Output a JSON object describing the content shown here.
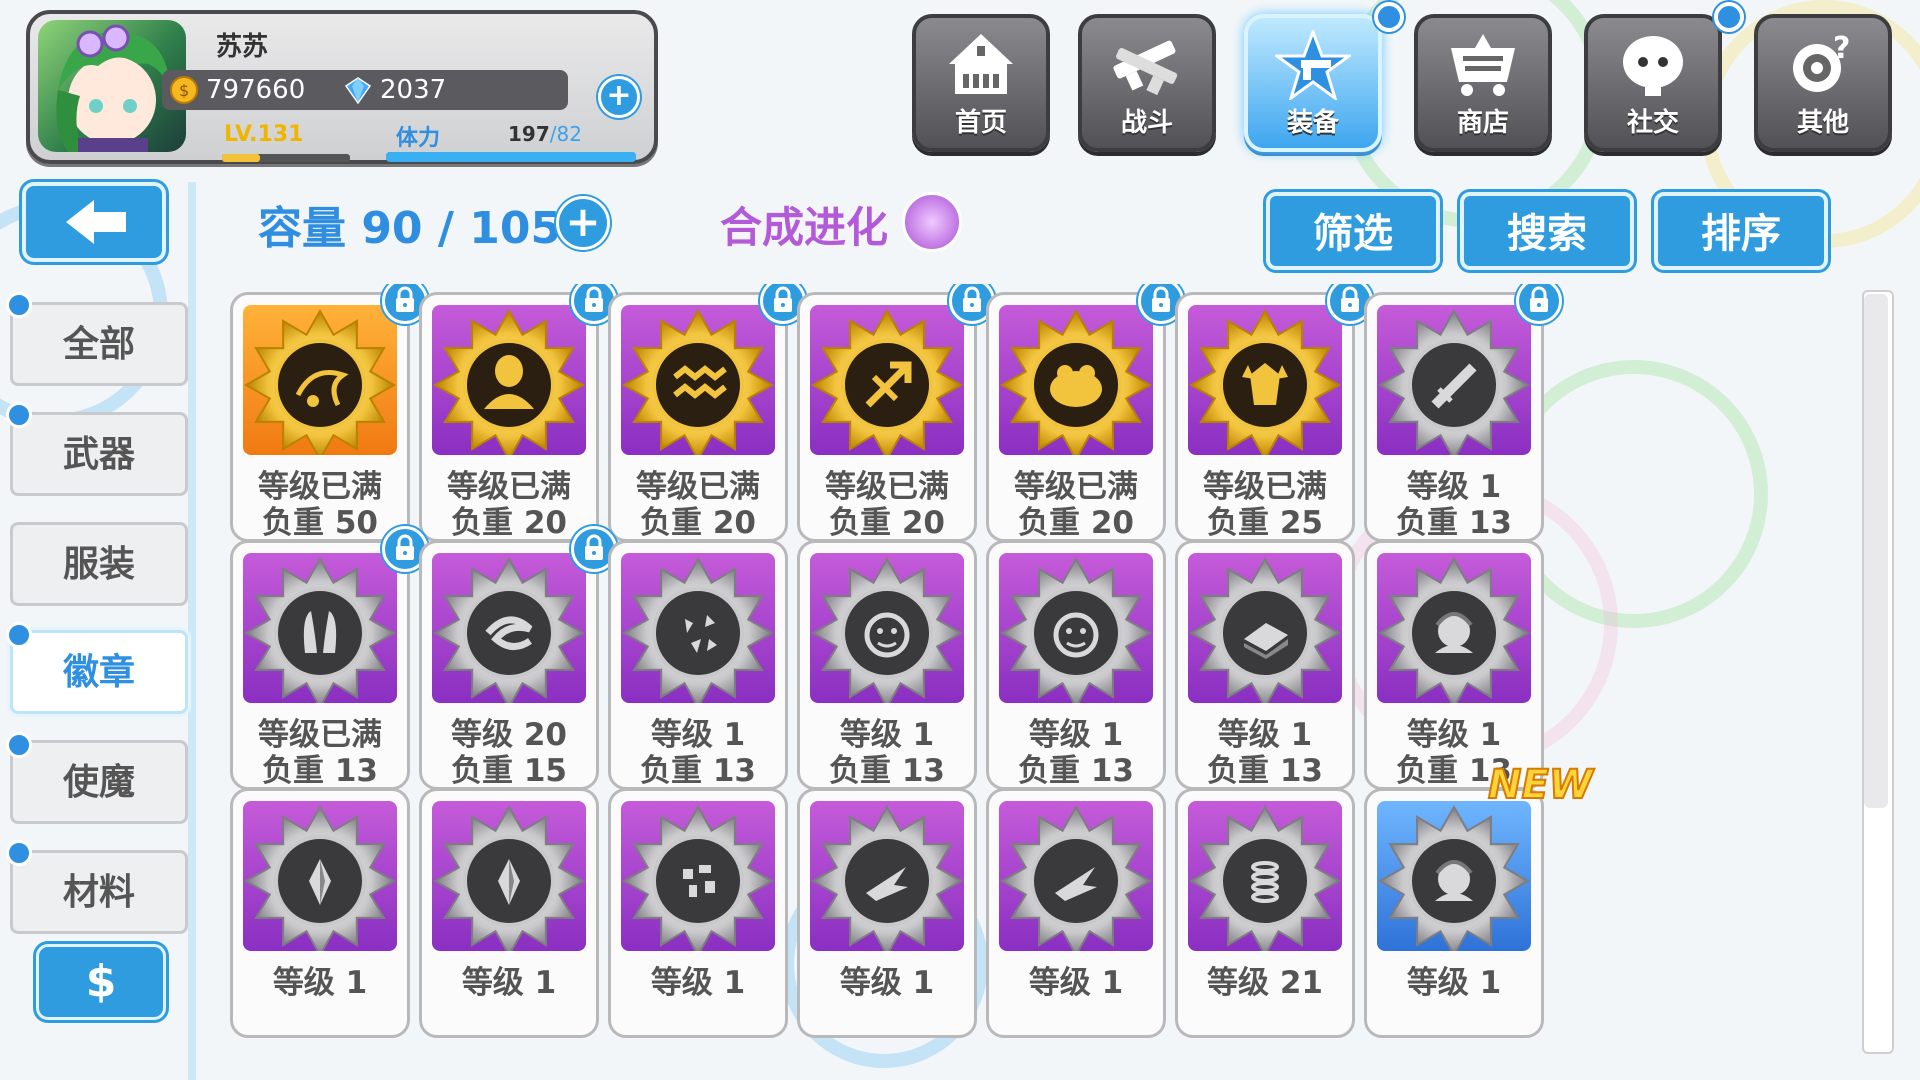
{
  "player": {
    "name": "苏苏",
    "gold": "797660",
    "gems": "2037",
    "level": "LV.131",
    "stamina_label": "体力",
    "stamina_current": "197",
    "stamina_max": "/82",
    "level_progress": 0.3,
    "stamina_progress": 1.0
  },
  "nav": {
    "items": [
      {
        "label": "首页",
        "icon": "house-icon",
        "active": false
      },
      {
        "label": "战斗",
        "icon": "crossed-guns-icon",
        "active": false
      },
      {
        "label": "装备",
        "icon": "star-gun-icon",
        "active": true
      },
      {
        "label": "商店",
        "icon": "cart-icon",
        "active": false
      },
      {
        "label": "社交",
        "icon": "ghost-face-icon",
        "active": false
      },
      {
        "label": "其他",
        "icon": "gear-target-icon",
        "active": false
      }
    ]
  },
  "sidebar": {
    "items": [
      {
        "label": "全部",
        "active": false
      },
      {
        "label": "武器",
        "active": false
      },
      {
        "label": "服装",
        "active": false
      },
      {
        "label": "徽章",
        "active": true
      },
      {
        "label": "使魔",
        "active": false
      },
      {
        "label": "材料",
        "active": false
      }
    ],
    "coin_button": "$"
  },
  "header": {
    "capacity": "容量 90 / 105",
    "synthesis": "合成进化",
    "filter": "筛选",
    "search": "搜索",
    "sort": "排序"
  },
  "badges": [
    {
      "line1": "等级已满",
      "line2": "负重 50",
      "frame": "gold",
      "bg": "orange",
      "locked": true,
      "motif": "vine"
    },
    {
      "line1": "等级已满",
      "line2": "负重 20",
      "frame": "gold",
      "bg": "purple",
      "locked": true,
      "motif": "figure"
    },
    {
      "line1": "等级已满",
      "line2": "负重 20",
      "frame": "gold",
      "bg": "purple",
      "locked": true,
      "motif": "aquarius"
    },
    {
      "line1": "等级已满",
      "line2": "负重 20",
      "frame": "gold",
      "bg": "purple",
      "locked": true,
      "motif": "sagittarius"
    },
    {
      "line1": "等级已满",
      "line2": "负重 20",
      "frame": "gold",
      "bg": "purple",
      "locked": true,
      "motif": "frog"
    },
    {
      "line1": "等级已满",
      "line2": "负重 25",
      "frame": "gold",
      "bg": "purple",
      "locked": true,
      "motif": "demon"
    },
    {
      "line1": "等级 1",
      "line2": "负重 13",
      "frame": "silver",
      "bg": "purple",
      "locked": true,
      "motif": "sword"
    },
    {
      "line1": "等级已满",
      "line2": "负重 13",
      "frame": "silver",
      "bg": "purple",
      "locked": true,
      "motif": "ears"
    },
    {
      "line1": "等级 20",
      "line2": "负重 15",
      "frame": "silver",
      "bg": "purple",
      "locked": true,
      "motif": "swirl"
    },
    {
      "line1": "等级 1",
      "line2": "负重 13",
      "frame": "silver",
      "bg": "purple",
      "locked": false,
      "motif": "shards"
    },
    {
      "line1": "等级 1",
      "line2": "负重 13",
      "frame": "silver",
      "bg": "purple",
      "locked": false,
      "motif": "face"
    },
    {
      "line1": "等级 1",
      "line2": "负重 13",
      "frame": "silver",
      "bg": "purple",
      "locked": false,
      "motif": "face"
    },
    {
      "line1": "等级 1",
      "line2": "负重 13",
      "frame": "silver",
      "bg": "purple",
      "locked": false,
      "motif": "book"
    },
    {
      "line1": "等级 1",
      "line2": "负重 13",
      "frame": "silver",
      "bg": "purple",
      "locked": false,
      "motif": "girl"
    },
    {
      "line1": "等级 1",
      "line2": "",
      "frame": "silver",
      "bg": "purple",
      "locked": false,
      "motif": "crystal"
    },
    {
      "line1": "等级 1",
      "line2": "",
      "frame": "silver",
      "bg": "purple",
      "locked": false,
      "motif": "crystal"
    },
    {
      "line1": "等级 1",
      "line2": "",
      "frame": "silver",
      "bg": "purple",
      "locked": false,
      "motif": "rubble"
    },
    {
      "line1": "等级 1",
      "line2": "",
      "frame": "silver",
      "bg": "purple",
      "locked": false,
      "motif": "wing"
    },
    {
      "line1": "等级 1",
      "line2": "",
      "frame": "silver",
      "bg": "purple",
      "locked": false,
      "motif": "wing"
    },
    {
      "line1": "等级 21",
      "line2": "",
      "frame": "silver",
      "bg": "purple",
      "locked": false,
      "motif": "spring"
    },
    {
      "line1": "等级 1",
      "line2": "",
      "frame": "silver",
      "bg": "blue",
      "locked": false,
      "motif": "girl",
      "is_new": true
    }
  ],
  "new_tag": "NEW",
  "colors": {
    "accent_blue": "#2f9ce0",
    "purple_text": "#b25ad8",
    "level_gold": "#f0b500"
  }
}
